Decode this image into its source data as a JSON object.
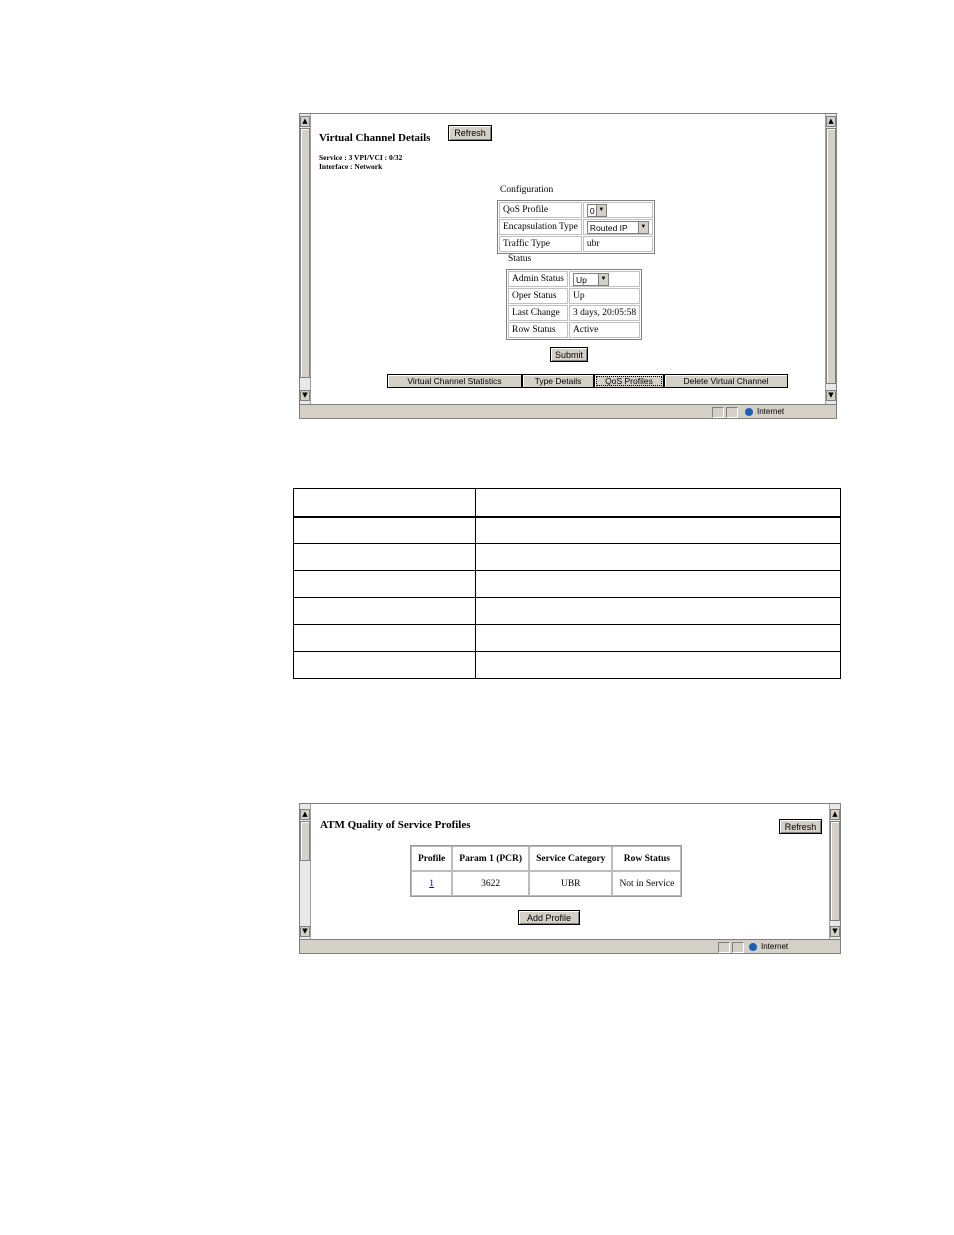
{
  "vc_window": {
    "title": "Virtual Channel Details",
    "refresh_label": "Refresh",
    "service_line": "Service : 3 VPI/VCI : 0/32",
    "interface_line": "Interface : Network",
    "configuration_heading": "Configuration",
    "config_rows": [
      {
        "label": "QoS Profile",
        "value": "0"
      },
      {
        "label": "Encapsulation Type",
        "value": "Routed IP"
      },
      {
        "label": "Traffic Type",
        "value": "ubr"
      }
    ],
    "status_heading": "Status",
    "status_rows": [
      {
        "label": "Admin Status",
        "value": "Up"
      },
      {
        "label": "Oper Status",
        "value": "Up"
      },
      {
        "label": "Last Change",
        "value": "3 days, 20:05:58"
      },
      {
        "label": "Row Status",
        "value": "Active"
      }
    ],
    "submit_label": "Submit",
    "tabs": [
      "Virtual Channel Statistics",
      "Type Details",
      "QoS Profiles",
      "Delete Virtual Channel"
    ],
    "status_bar_zone": "Internet"
  },
  "doc_table": {
    "rows": 7
  },
  "qos_window": {
    "title": "ATM Quality of Service Profiles",
    "refresh_label": "Refresh",
    "headers": [
      "Profile",
      "Param 1 (PCR)",
      "Service Category",
      "Row Status"
    ],
    "row": {
      "profile": "1",
      "param1": "3622",
      "service_category": "UBR",
      "row_status": "Not in Service"
    },
    "add_profile_label": "Add Profile",
    "status_bar_zone": "Internet"
  }
}
